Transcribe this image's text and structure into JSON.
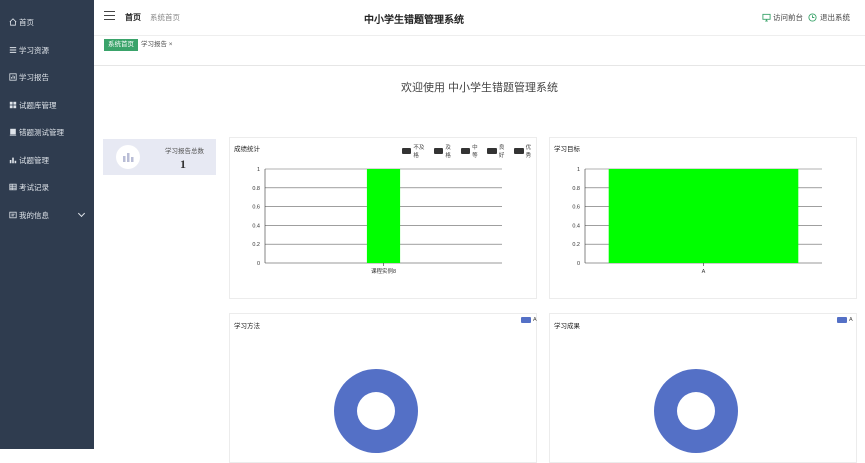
{
  "sidebar": {
    "items": [
      {
        "label": "首页",
        "icon": "home-icon"
      },
      {
        "label": "学习资源",
        "icon": "list-icon"
      },
      {
        "label": "学习报告",
        "icon": "report-icon"
      },
      {
        "label": "试题库管理",
        "icon": "grid-icon"
      },
      {
        "label": "错题测试管理",
        "icon": "test-icon"
      },
      {
        "label": "试题管理",
        "icon": "bar-chart-icon"
      },
      {
        "label": "考试记录",
        "icon": "table-icon"
      },
      {
        "label": "我的信息",
        "icon": "user-card-icon"
      }
    ]
  },
  "header": {
    "home_label": "首页",
    "sys_label": "系统首页",
    "title": "中小学生错题管理系统",
    "visit_label": "访问前台",
    "logout_label": "退出系统"
  },
  "tabs": {
    "active": "系统首页",
    "other": "学习报告 ×"
  },
  "welcome": "欢迎使用 中小学生错题管理系统",
  "stat": {
    "label": "学习报告总数",
    "value": "1"
  },
  "colors": {
    "sidebar": "#2f3c4f",
    "accent": "#3aa36a",
    "bar": "#00ff00",
    "pie": "#5470c6",
    "legend_dark": "#333333"
  },
  "chart_data": [
    {
      "type": "bar",
      "title": "成绩统计",
      "legend": [
        "不及格",
        "及格",
        "中等",
        "良好",
        "优秀"
      ],
      "categories": [
        "课程实例8"
      ],
      "values": [
        1
      ],
      "ylim": [
        0,
        1
      ],
      "yticks": [
        "0",
        "0.2",
        "0.4",
        "0.6",
        "0.8",
        "1"
      ]
    },
    {
      "type": "bar",
      "title": "学习目标",
      "categories": [
        "A"
      ],
      "values": [
        1
      ],
      "ylim": [
        0,
        1
      ],
      "yticks": [
        "0",
        "0.2",
        "0.4",
        "0.6",
        "0.8",
        "1"
      ]
    },
    {
      "type": "pie",
      "title": "学习方法",
      "legend": [
        "A"
      ],
      "slices": [
        {
          "name": "A",
          "value": 1
        }
      ]
    },
    {
      "type": "pie",
      "title": "学习成果",
      "legend": [
        "A"
      ],
      "slices": [
        {
          "name": "A",
          "value": 1
        }
      ]
    }
  ]
}
